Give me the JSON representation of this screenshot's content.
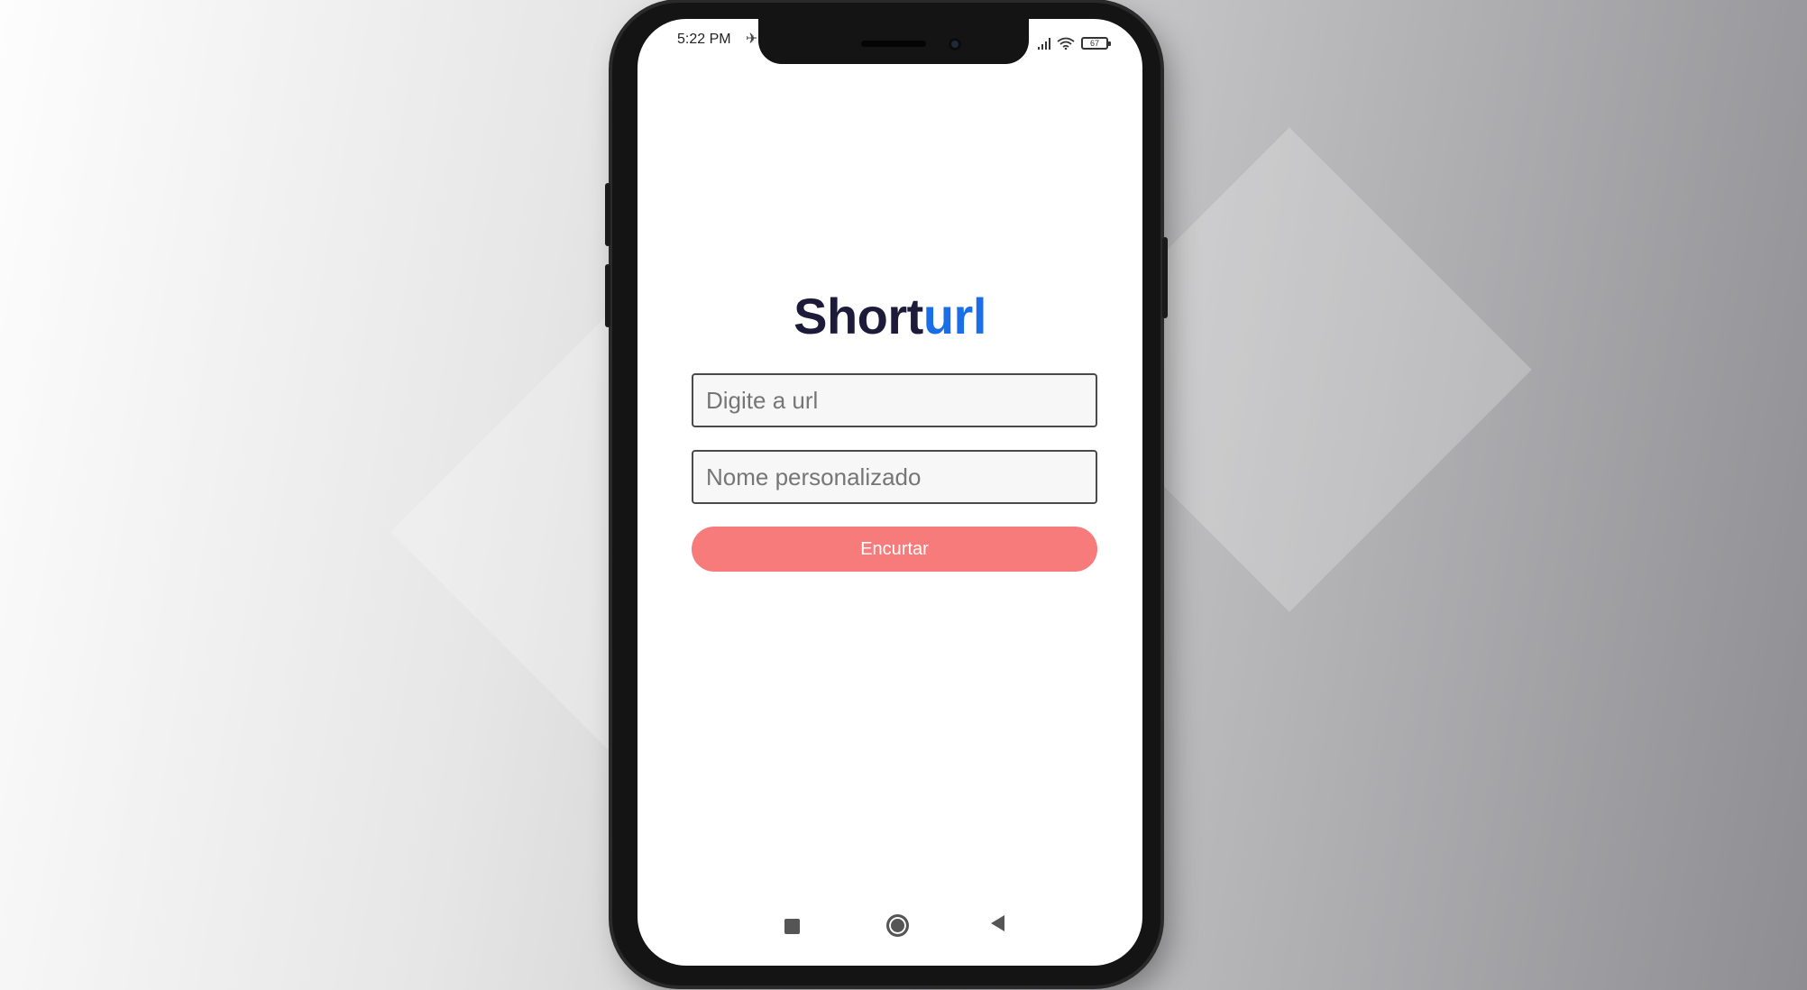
{
  "status_bar": {
    "time": "5:22 PM",
    "battery_level": "67",
    "icons": [
      "signal-icon",
      "wifi-icon",
      "battery-icon"
    ]
  },
  "app": {
    "title_part_1": "Short",
    "title_part_2": "url"
  },
  "form": {
    "url_placeholder": "Digite a url",
    "name_placeholder": "Nome personalizado",
    "url_value": "",
    "name_value": "",
    "submit_label": "Encurtar"
  },
  "nav_bar": {
    "icons": [
      "recent-apps-icon",
      "home-icon",
      "back-icon"
    ]
  },
  "colors": {
    "title_dark": "#1e1b3a",
    "title_accent": "#1a6ee8",
    "button": "#f77b7b",
    "button_text": "#ffffff"
  }
}
